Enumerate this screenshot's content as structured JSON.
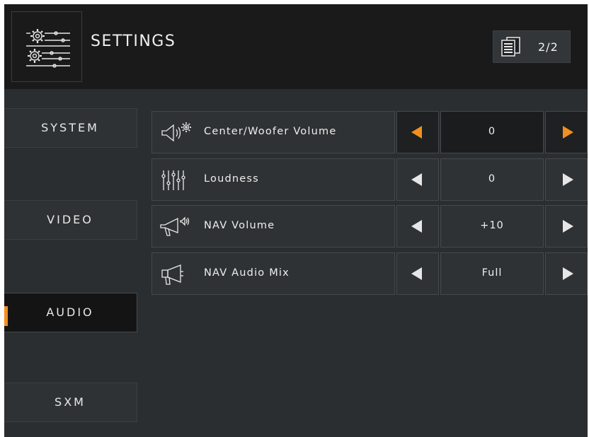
{
  "header": {
    "title": "SETTINGS",
    "settings_icon": "settings-gears-sliders-icon",
    "page_icon": "pages-icon",
    "page_indicator": "2/2"
  },
  "sidebar": {
    "items": [
      {
        "label": "SYSTEM",
        "active": false
      },
      {
        "label": "VIDEO",
        "active": false
      },
      {
        "label": "AUDIO",
        "active": true
      },
      {
        "label": "SXM",
        "active": false
      }
    ]
  },
  "settings": [
    {
      "label": "Center/Woofer Volume",
      "value": "0",
      "icon": "speaker-gear-icon",
      "focused": true
    },
    {
      "label": "Loudness",
      "value": "0",
      "icon": "equalizer-sliders-icon",
      "focused": false
    },
    {
      "label": "NAV Volume",
      "value": "+10",
      "icon": "megaphone-volume-icon",
      "focused": false
    },
    {
      "label": "NAV Audio Mix",
      "value": "Full",
      "icon": "megaphone-icon",
      "focused": false
    }
  ],
  "colors": {
    "accent": "#f28f20",
    "background": "#2b2e30",
    "header_background": "#1a1a1b"
  }
}
